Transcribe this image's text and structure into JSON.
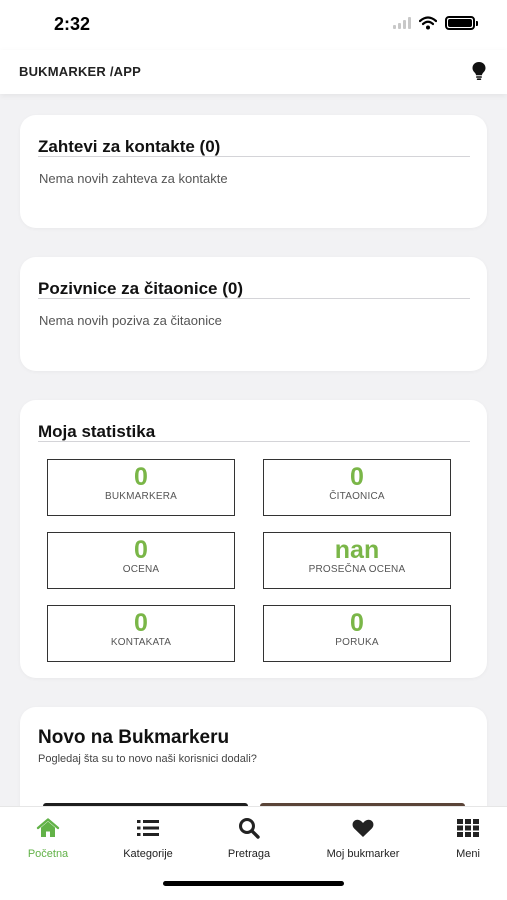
{
  "status_bar": {
    "time": "2:32"
  },
  "header": {
    "title": "BUKMARKER /APP",
    "icon": "lightbulb-icon"
  },
  "cards": {
    "contact_requests": {
      "title": "Zahtevi za kontakte (0)",
      "empty_text": "Nema novih zahteva za kontakte"
    },
    "reading_room_invites": {
      "title": "Pozivnice za čitaonice (0)",
      "empty_text": "Nema novih poziva za čitaonice"
    },
    "statistics": {
      "title": "Moja statistika",
      "items": [
        {
          "value": "0",
          "label": "BUKMARKERA"
        },
        {
          "value": "0",
          "label": "ČITAONICA"
        },
        {
          "value": "0",
          "label": "OCENA"
        },
        {
          "value": "nan",
          "label": "PROSEČNA OCENA"
        },
        {
          "value": "0",
          "label": "KONTAKATA"
        },
        {
          "value": "0",
          "label": "PORUKA"
        }
      ]
    },
    "new_on_bukmarker": {
      "title": "Novo na Bukmarkeru",
      "subtitle": "Pogledaj šta su to novo naši korisnici dodali?"
    }
  },
  "tab_bar": {
    "tabs": [
      {
        "label": "Početna",
        "icon": "home-icon",
        "active": true
      },
      {
        "label": "Kategorije",
        "icon": "list-icon",
        "active": false
      },
      {
        "label": "Pretraga",
        "icon": "search-icon",
        "active": false
      },
      {
        "label": "Moj bukmarker",
        "icon": "heart-icon",
        "active": false
      },
      {
        "label": "Meni",
        "icon": "grid-icon",
        "active": false
      }
    ]
  },
  "colors": {
    "accent": "#7ab648",
    "active_tab": "#62b248",
    "background": "#f2f2f4"
  }
}
